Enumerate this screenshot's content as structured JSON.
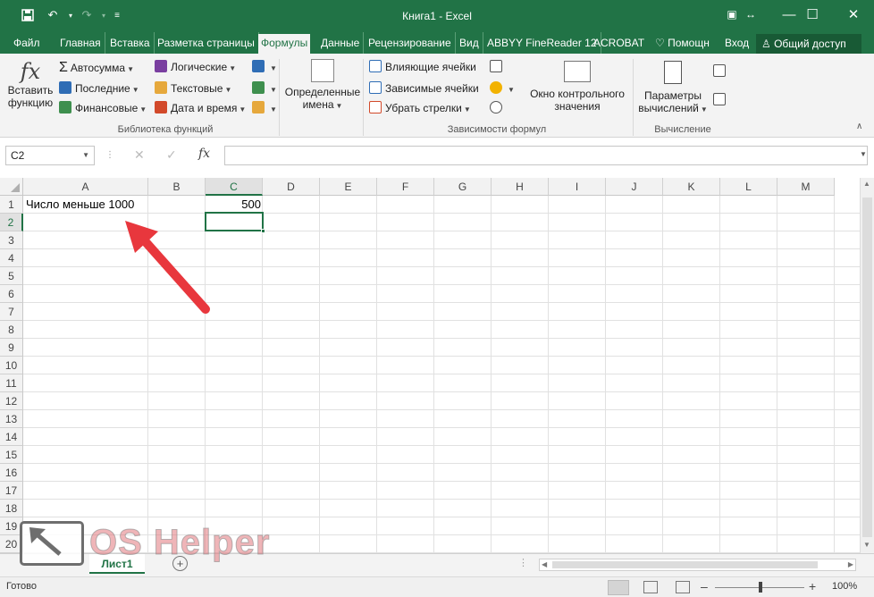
{
  "title": "Книга1 - Excel",
  "menu": {
    "tabs": [
      "Файл",
      "Главная",
      "Вставка",
      "Разметка страницы",
      "Формулы",
      "Данные",
      "Рецензирование",
      "Вид",
      "ABBYY FineReader 12",
      "ACROBAT"
    ],
    "tell": "Помощн",
    "login": "Вход",
    "share": "Общий доступ"
  },
  "ribbon": {
    "insert_fn_line1": "Вставить",
    "insert_fn_line2": "функцию",
    "autosum": "Автосумма",
    "recent": "Последние",
    "financial": "Финансовые",
    "logical": "Логические",
    "text": "Текстовые",
    "datetime": "Дата и время",
    "defined_names_1": "Определенные",
    "defined_names_2": "имена",
    "trace_precedents": "Влияющие ячейки",
    "trace_dependents": "Зависимые ячейки",
    "remove_arrows": "Убрать стрелки",
    "watch_1": "Окно контрольного",
    "watch_2": "значения",
    "calc_opts_1": "Параметры",
    "calc_opts_2": "вычислений",
    "group_library": "Библиотека функций",
    "group_dependencies": "Зависимости формул",
    "group_calc": "Вычисление"
  },
  "formula_bar": {
    "name_box": "C2",
    "fx": "fx",
    "formula": ""
  },
  "grid": {
    "columns": [
      "A",
      "B",
      "C",
      "D",
      "E",
      "F",
      "G",
      "H",
      "I",
      "J",
      "K",
      "L",
      "M"
    ],
    "rows": [
      "1",
      "2",
      "3",
      "4",
      "5",
      "6",
      "7",
      "8",
      "9",
      "10",
      "11",
      "12",
      "13",
      "14",
      "15",
      "16",
      "17",
      "18",
      "19",
      "20"
    ],
    "cells": {
      "A1": "Число меньше 1000",
      "C1": "500"
    },
    "selected": "C2"
  },
  "sheets": {
    "active": "Лист1"
  },
  "status": {
    "ready": "Готово",
    "zoom": "100%"
  },
  "watermark": {
    "brand": "OS Helper"
  },
  "colors": {
    "accent": "#217346",
    "arrow": "#e8373d"
  },
  "icons": [
    "save-icon",
    "undo-icon",
    "redo-icon",
    "fx-icon",
    "sigma-icon",
    "plus-icon"
  ]
}
